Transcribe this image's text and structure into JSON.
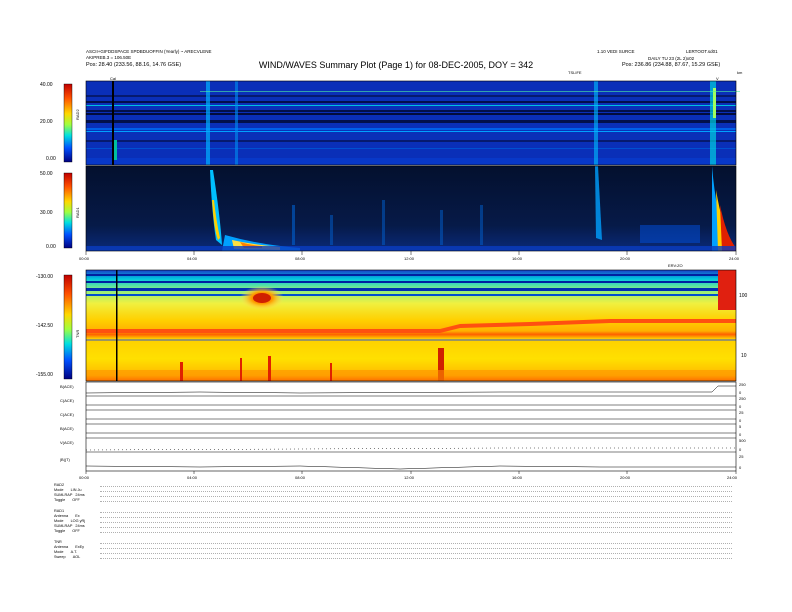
{
  "header": {
    "title": "WIND/WAVES Summary Plot (Page 1) for 08-DEC-2005, DOY = 342",
    "left_line1": "ASCII+GIFDDSPACE SPDBDUOFFIN (Yearly) ~ ARECVLENE",
    "left_line2": "AKIPREB.3 = 106.50E",
    "left_line3": "Pos: 28.40 (233.56, 88.16, 14.76 GSE)",
    "right_line1": "1.10 VEDI SURCE",
    "right_line2": "LERTOOT.sd01",
    "right_line3": "DAILY TU 23 (2L 2)x02",
    "right_line4": "Pos: 236.86 (234.88, 87.67, 15.29 GSE)",
    "marker_cal": "Cal",
    "marker_tslife": "TSLIFE",
    "marker_km": "km",
    "marker_v": "V"
  },
  "colorbars": {
    "rad2": {
      "label": "RAD2",
      "ticks": [
        "40.00",
        "20.00",
        "0.00"
      ]
    },
    "rad1": {
      "label": "RAD1",
      "ticks": [
        "50.00",
        "30.00",
        "0.00"
      ]
    },
    "tnr": {
      "label": "TNR",
      "ticks": [
        "-130.00",
        "-142.50",
        "-155.00"
      ]
    }
  },
  "tnr_right_ticks": [
    "100",
    "10"
  ],
  "tnr_right_marker": "ERV:ZO",
  "time_axis": {
    "ticks": [
      "00:00",
      "04:00",
      "08:00",
      "12:00",
      "16:00",
      "20:00",
      "24:00"
    ],
    "bottom_ticks": [
      "00:00",
      "04:00",
      "08:00",
      "12:00",
      "16:00",
      "20:00",
      "24:00"
    ]
  },
  "ephemeris": {
    "rows": [
      {
        "label": "B(ACE)"
      },
      {
        "label": "C(ACE)"
      },
      {
        "label": "C(ACE)"
      },
      {
        "label": "B(ACE)"
      },
      {
        "label": "V(ACE)"
      },
      {
        "label": "|B|(T)"
      }
    ],
    "right_ticks": [
      "250",
      "0",
      "250",
      "0",
      "25",
      "0",
      "5",
      "0",
      "500",
      "0",
      "25",
      "0"
    ]
  },
  "bottom_table": {
    "rows": [
      [
        "RAD2",
        ""
      ],
      [
        "Mode",
        "LIN Ju"
      ],
      [
        "SUMLRAP",
        "24ms"
      ],
      [
        "Toggle",
        "OFF"
      ],
      [
        "RAD1",
        ""
      ],
      [
        "Antenna",
        "Ex"
      ],
      [
        "Mode",
        "LOG yRj"
      ],
      [
        "SUMLRAP",
        "24ms"
      ],
      [
        "Toggle",
        "OFF"
      ],
      [
        "TNR",
        ""
      ],
      [
        "Antenna",
        "ExEy"
      ],
      [
        "Mode",
        "A.T."
      ],
      [
        "Sweep",
        "AOL"
      ]
    ]
  },
  "colors": {
    "background": "#ffffff",
    "plot_blue": "#0a2db4",
    "plot_dark": "#061846",
    "tnr_yellow": "#f2e000",
    "tnr_red": "#e0200a",
    "tnr_cyan": "#00d0e0"
  }
}
